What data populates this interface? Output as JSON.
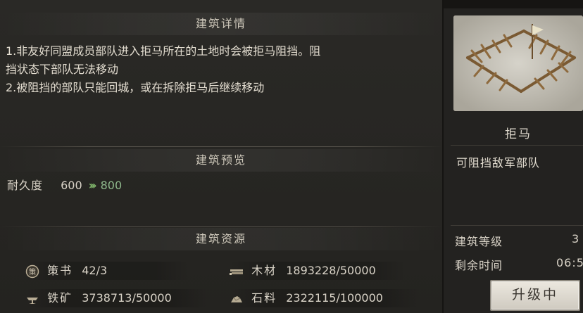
{
  "details": {
    "title": "建筑详情",
    "lines": [
      "1.非友好同盟成员部队进入拒马所在的土地时会被拒马阻挡。阻",
      "挡状态下部队无法移动",
      "2.被阻挡的部队只能回城，或在拆除拒马后继续移动"
    ]
  },
  "preview": {
    "title": "建筑预览",
    "durability_label": "耐久度",
    "durability_from": "600",
    "durability_arrows": "»",
    "durability_to": "800"
  },
  "resources": {
    "title": "建筑资源",
    "items": [
      {
        "name": "策书",
        "value": "42/3",
        "icon": "scroll-icon"
      },
      {
        "name": "木材",
        "value": "1893228/50000",
        "icon": "wood-icon"
      },
      {
        "name": "铁矿",
        "value": "3738713/50000",
        "icon": "iron-icon"
      },
      {
        "name": "石料",
        "value": "2322115/100000",
        "icon": "stone-icon"
      }
    ]
  },
  "building": {
    "name": "拒马",
    "description": "可阻挡敌军部队",
    "level_label": "建筑等级",
    "level_value": "3",
    "time_label": "剩余时间",
    "time_value": "06:5",
    "button": "升级中"
  },
  "colors": {
    "arrow": "#7fb56b",
    "new_value": "#8fb98c"
  }
}
